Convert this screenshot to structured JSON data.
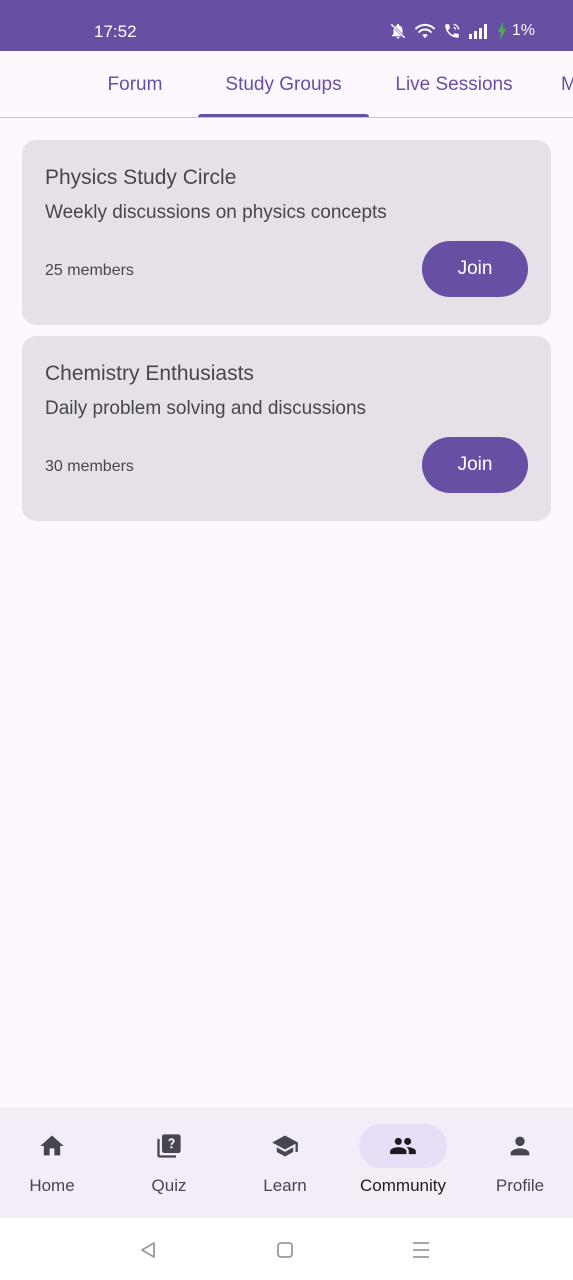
{
  "status_bar": {
    "time": "17:52",
    "battery": "1%",
    "icons": [
      "bell-off-icon",
      "wifi-icon",
      "wifi-call-icon",
      "signal-icon",
      "battery-charging-icon"
    ]
  },
  "tabs": [
    {
      "label": "Forum",
      "selected": false
    },
    {
      "label": "Study Groups",
      "selected": true
    },
    {
      "label": "Live Sessions",
      "selected": false
    },
    {
      "label": "M",
      "selected": false
    }
  ],
  "groups": [
    {
      "title": "Physics Study Circle",
      "description": "Weekly discussions on physics concepts",
      "members": "25 members",
      "action": "Join"
    },
    {
      "title": "Chemistry Enthusiasts",
      "description": "Daily problem solving and discussions",
      "members": "30 members",
      "action": "Join"
    }
  ],
  "bottom_nav": [
    {
      "label": "Home",
      "icon": "home-icon",
      "selected": false
    },
    {
      "label": "Quiz",
      "icon": "quiz-icon",
      "selected": false
    },
    {
      "label": "Learn",
      "icon": "school-icon",
      "selected": false
    },
    {
      "label": "Community",
      "icon": "people-icon",
      "selected": true
    },
    {
      "label": "Profile",
      "icon": "person-icon",
      "selected": false
    }
  ],
  "system_nav": [
    "back-icon",
    "home-square-icon",
    "menu-icon"
  ],
  "colors": {
    "primary": "#6750a4",
    "surface": "#fef7ff",
    "card": "#e6e0e9",
    "nav_background": "#f3edf7",
    "nav_active_pill": "#e8def8",
    "text_secondary": "#49454f"
  }
}
